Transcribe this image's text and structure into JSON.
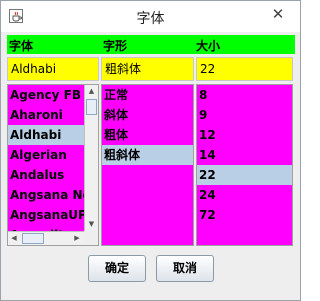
{
  "window": {
    "title": "字体",
    "close_glyph": "✕",
    "icon": "java-cup-icon"
  },
  "headers": {
    "font": "字体",
    "style": "字形",
    "size": "大小"
  },
  "fields": {
    "font": "Aldhabi",
    "style": "粗斜体",
    "size": "22"
  },
  "font_list": {
    "items": [
      "Agency FB",
      "Aharoni",
      "Aldhabi",
      "Algerian",
      "Andalus",
      "Angsana New",
      "AngsanaUPC",
      "Aparajita"
    ],
    "selected": "Aldhabi"
  },
  "style_list": {
    "items": [
      "正常",
      "斜体",
      "粗体",
      "粗斜体"
    ],
    "selected": "粗斜体"
  },
  "size_list": {
    "items": [
      "8",
      "9",
      "12",
      "14",
      "22",
      "24",
      "72"
    ],
    "selected": "22"
  },
  "buttons": {
    "ok": "确定",
    "cancel": "取消"
  },
  "colors": {
    "header_bg": "#00ff00",
    "field_bg": "#ffff00",
    "list_bg": "#ff00ff",
    "selection_bg": "#b8cfe5"
  }
}
